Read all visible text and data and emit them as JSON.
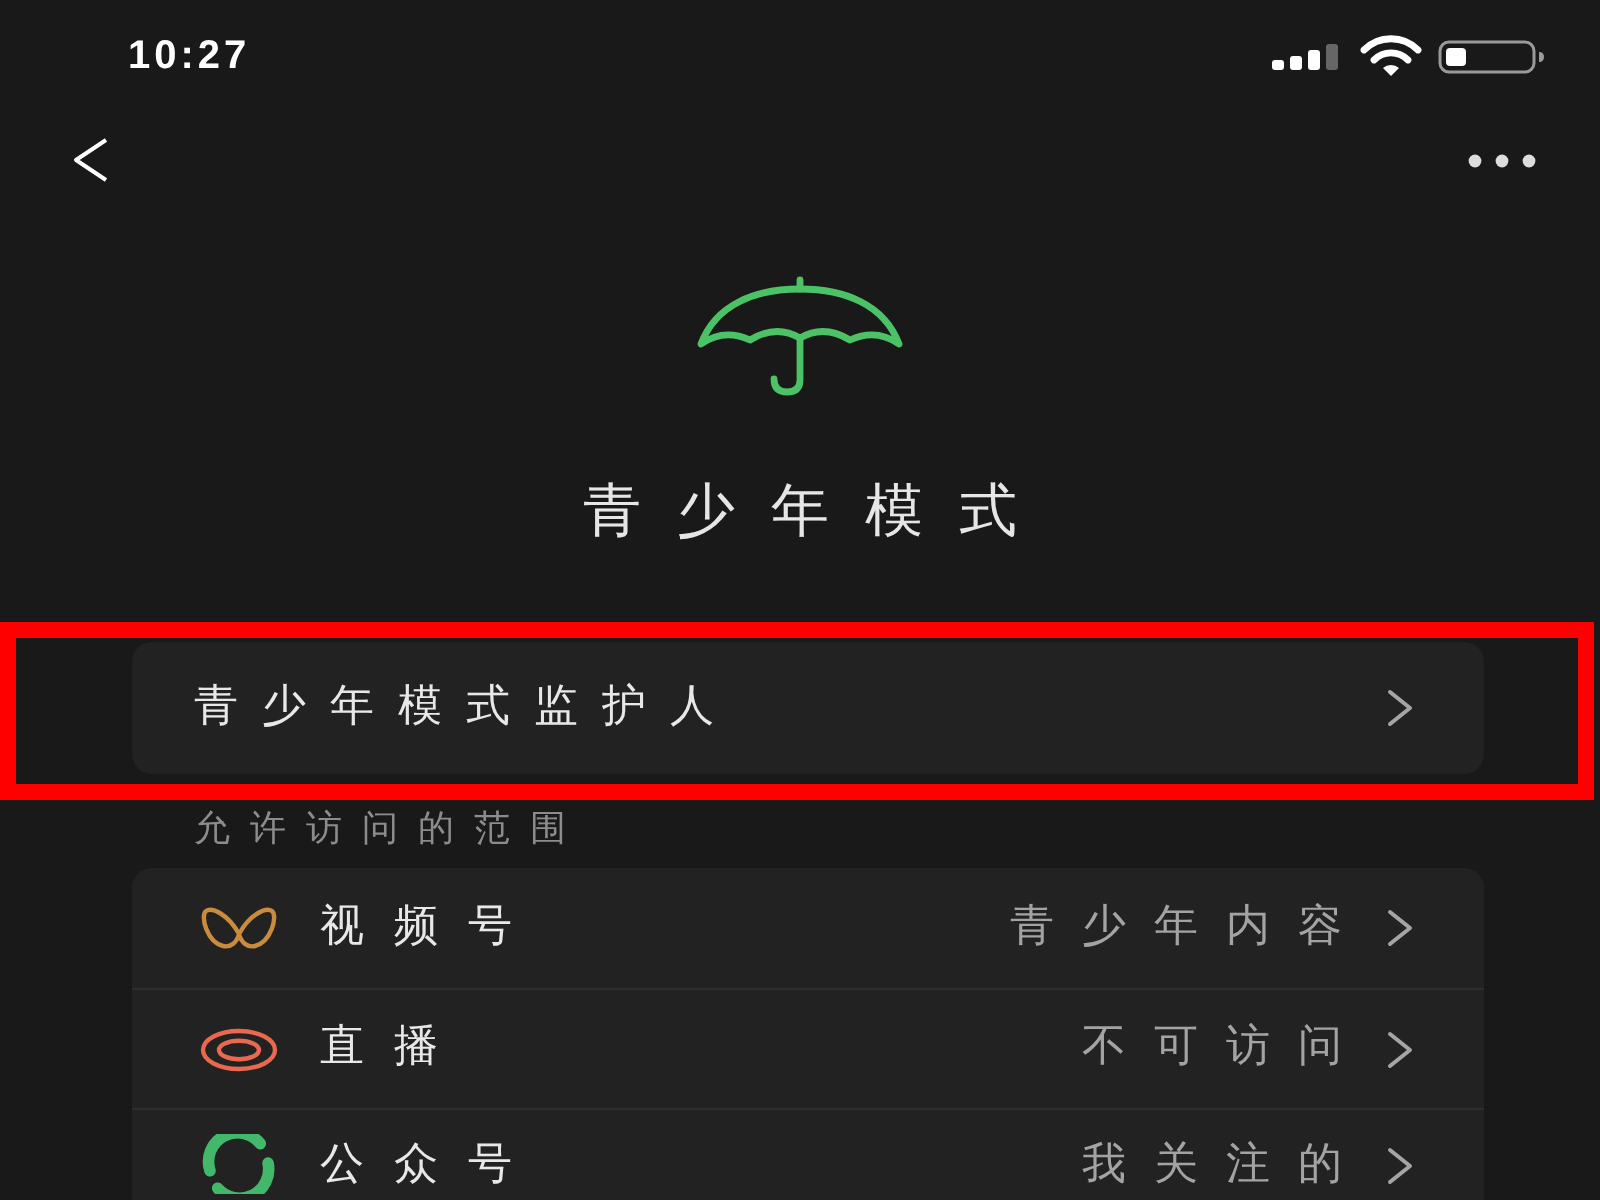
{
  "status_bar": {
    "time": "10:27"
  },
  "header": {
    "title": "青少年模式"
  },
  "guardian": {
    "label": "青少年模式监护人",
    "highlighted": true
  },
  "access": {
    "heading": "允许访问的范围",
    "items": [
      {
        "kind": "channels",
        "label": "视频号",
        "value": "青少年内容"
      },
      {
        "kind": "live",
        "label": "直播",
        "value": "不可访问"
      },
      {
        "kind": "official",
        "label": "公众号",
        "value": "我关注的"
      }
    ]
  }
}
